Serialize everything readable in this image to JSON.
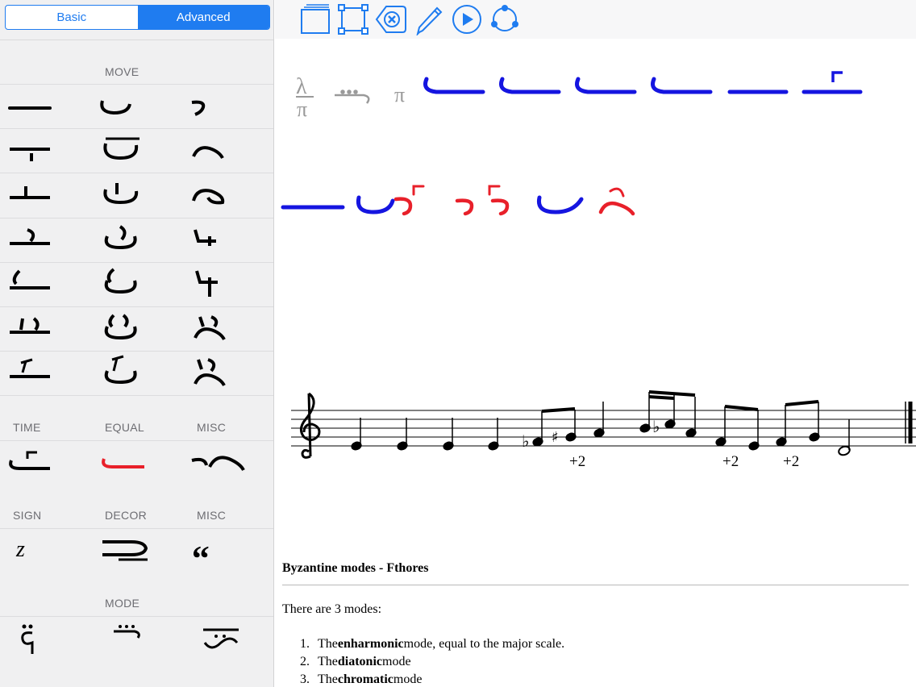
{
  "mode_switch": {
    "basic_label": "Basic",
    "advanced_label": "Advanced",
    "selected": "Advanced"
  },
  "palette": {
    "move_header": "MOVE",
    "time_header": "TIME",
    "equal_header": "EQUAL",
    "misc_header": "MISC",
    "sign_header": "SIGN",
    "decor_header": "DECOR",
    "misc2_header": "MISC",
    "mode_header": "MODE",
    "sign_glyph": "z",
    "misc_glyph": "”"
  },
  "toolbar": {
    "icons": [
      "pages-icon",
      "select-frame-icon",
      "delete-circle-icon",
      "pencil-icon",
      "play-circle-icon",
      "sync-circle-icon"
    ]
  },
  "score": {
    "header_glyphs": {
      "lambda": "λ",
      "pi_small": "π",
      "pi": "π"
    },
    "colors": {
      "neume_blue": "#1515e0",
      "neume_red": "#e8202a",
      "header_gray": "#9a9a9a",
      "accent": "#1f7cf0"
    },
    "accidentals": [
      "+2",
      "+2",
      "+2"
    ]
  },
  "document": {
    "title": "Byzantine modes - Fthores",
    "intro": "There are 3 modes:",
    "items": [
      {
        "num": "1.",
        "pre": "The ",
        "bold": "enharmonic",
        "post": " mode, equal to the major scale."
      },
      {
        "num": "2.",
        "pre": "The ",
        "bold": "diatonic",
        "post": " mode"
      },
      {
        "num": "3.",
        "pre": "The ",
        "bold": "chromatic",
        "post": " mode"
      }
    ]
  }
}
